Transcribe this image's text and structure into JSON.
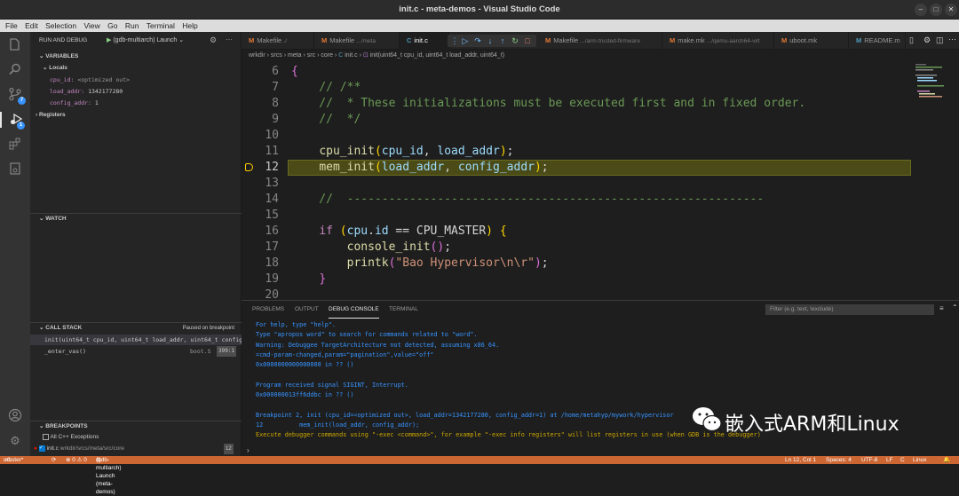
{
  "window": {
    "title": "init.c - meta-demos - Visual Studio Code"
  },
  "menu": [
    "File",
    "Edit",
    "Selection",
    "View",
    "Go",
    "Run",
    "Terminal",
    "Help"
  ],
  "sidebar": {
    "run_label": "RUN AND DEBUG",
    "config": "(gdb-multiarch) Launch",
    "variables_label": "VARIABLES",
    "locals_label": "Locals",
    "locals": [
      {
        "name": "cpu_id:",
        "value": "<optimized out>"
      },
      {
        "name": "load_addr:",
        "value": "1342177280"
      },
      {
        "name": "config_addr:",
        "value": "1"
      }
    ],
    "registers_label": "Registers",
    "watch_label": "WATCH",
    "callstack_label": "CALL STACK",
    "callstack_status": "Paused on breakpoint",
    "frames": [
      {
        "name": "init(uint64_t cpu_id, uint64_t load_addr, uint64_t config",
        "file": ""
      },
      {
        "name": "_enter_vas()",
        "file": "boot.S",
        "line": "399:1"
      }
    ],
    "breakpoints_label": "BREAKPOINTS",
    "breakpoints": [
      {
        "label": "All C++ Exceptions",
        "path": "",
        "count": ""
      },
      {
        "label": "init.c",
        "path": "wrkdir/srcs/meta/src/core",
        "count": "12"
      }
    ]
  },
  "activity": {
    "source_control_badge": "7",
    "debug_badge": "1"
  },
  "tabs": [
    {
      "name": "Makefile",
      "dir": "./"
    },
    {
      "name": "Makefile",
      "dir": ".../meta"
    },
    {
      "name": "init.c",
      "dir": ""
    },
    {
      "name": "Makefile",
      "dir": ".../arm-trusted-firmware"
    },
    {
      "name": "make.mk",
      "dir": ".../qemu-aarch64-virt"
    },
    {
      "name": "uboot.mk",
      "dir": ""
    },
    {
      "name": "README.m",
      "dir": ""
    }
  ],
  "breadcrumb": [
    "wrkdir",
    "srcs",
    "meta",
    "src",
    "core",
    "init.c",
    "init(uint64_t cpu_id, uint64_t load_addr, uint64_t)"
  ],
  "code": {
    "current_line": 12,
    "lines": [
      {
        "n": "6",
        "tokens": [
          {
            "t": "{",
            "c": "c-br2"
          }
        ]
      },
      {
        "n": "7",
        "tokens": [
          {
            "t": "    // /**",
            "c": "c-com"
          }
        ]
      },
      {
        "n": "8",
        "tokens": [
          {
            "t": "    //  * These initializations must be executed first and in fixed order.",
            "c": "c-com"
          }
        ]
      },
      {
        "n": "9",
        "tokens": [
          {
            "t": "    //  */",
            "c": "c-com"
          }
        ]
      },
      {
        "n": "10",
        "tokens": []
      },
      {
        "n": "11",
        "tokens": [
          {
            "t": "    ",
            "c": "c-def"
          },
          {
            "t": "cpu_init",
            "c": "c-fn"
          },
          {
            "t": "(",
            "c": "c-brace"
          },
          {
            "t": "cpu_id",
            "c": "c-var"
          },
          {
            "t": ", ",
            "c": "c-def"
          },
          {
            "t": "load_addr",
            "c": "c-var"
          },
          {
            "t": ")",
            "c": "c-brace"
          },
          {
            "t": ";",
            "c": "c-def"
          }
        ]
      },
      {
        "n": "12",
        "tokens": [
          {
            "t": "    ",
            "c": "c-def"
          },
          {
            "t": "mem_init",
            "c": "c-fn"
          },
          {
            "t": "(",
            "c": "c-brace"
          },
          {
            "t": "load_addr",
            "c": "c-var"
          },
          {
            "t": ", ",
            "c": "c-def"
          },
          {
            "t": "config_addr",
            "c": "c-var"
          },
          {
            "t": ")",
            "c": "c-brace"
          },
          {
            "t": ";",
            "c": "c-def"
          }
        ]
      },
      {
        "n": "13",
        "tokens": []
      },
      {
        "n": "14",
        "tokens": [
          {
            "t": "    //  ------------------------------------------------------------",
            "c": "c-com"
          }
        ]
      },
      {
        "n": "15",
        "tokens": []
      },
      {
        "n": "16",
        "tokens": [
          {
            "t": "    ",
            "c": "c-def"
          },
          {
            "t": "if",
            "c": "c-kw"
          },
          {
            "t": " ",
            "c": "c-def"
          },
          {
            "t": "(",
            "c": "c-brace"
          },
          {
            "t": "cpu",
            "c": "c-var"
          },
          {
            "t": ".",
            "c": "c-def"
          },
          {
            "t": "id",
            "c": "c-var"
          },
          {
            "t": " == CPU_MASTER",
            "c": "c-def"
          },
          {
            "t": ")",
            "c": "c-brace"
          },
          {
            "t": " ",
            "c": "c-def"
          },
          {
            "t": "{",
            "c": "c-brace"
          }
        ]
      },
      {
        "n": "17",
        "tokens": [
          {
            "t": "        ",
            "c": "c-def"
          },
          {
            "t": "console_init",
            "c": "c-fn"
          },
          {
            "t": "()",
            "c": "c-br2"
          },
          {
            "t": ";",
            "c": "c-def"
          }
        ]
      },
      {
        "n": "18",
        "tokens": [
          {
            "t": "        ",
            "c": "c-def"
          },
          {
            "t": "printk",
            "c": "c-fn"
          },
          {
            "t": "(",
            "c": "c-br2"
          },
          {
            "t": "\"Bao Hypervisor\\n\\r\"",
            "c": "c-str"
          },
          {
            "t": ")",
            "c": "c-br2"
          },
          {
            "t": ";",
            "c": "c-def"
          }
        ]
      },
      {
        "n": "19",
        "tokens": [
          {
            "t": "    ",
            "c": "c-def"
          },
          {
            "t": "}",
            "c": "c-br2"
          }
        ]
      },
      {
        "n": "20",
        "tokens": []
      }
    ]
  },
  "panel": {
    "tabs": [
      "PROBLEMS",
      "OUTPUT",
      "DEBUG CONSOLE",
      "TERMINAL"
    ],
    "active_tab": "DEBUG CONSOLE",
    "filter_placeholder": "Filter (e.g. text, !exclude)",
    "console": [
      {
        "text": "For help, type \"help\".",
        "c": ""
      },
      {
        "text": "Type \"apropos word\" to search for commands related to \"word\".",
        "c": ""
      },
      {
        "text": "Warning: Debuggee TargetArchitecture not detected, assuming x86_64.",
        "c": ""
      },
      {
        "text": "=cmd-param-changed,param=\"pagination\",value=\"off\"",
        "c": ""
      },
      {
        "text": "0x0000000000000000 in ?? ()",
        "c": ""
      },
      {
        "text": "",
        "c": ""
      },
      {
        "text": "Program received signal SIGINT, Interrupt.",
        "c": ""
      },
      {
        "text": "0x000000013ff6ddbc in ?? ()",
        "c": ""
      },
      {
        "text": "",
        "c": ""
      },
      {
        "text": "Breakpoint 2, init (cpu_id=<optimized out>, load_addr=1342177280, config_addr=1) at /home/metahyp/mywork/hypervisor",
        "c": ""
      },
      {
        "text": "12          mem_init(load_addr, config_addr);",
        "c": ""
      },
      {
        "text": "Execute debugger commands using \"-exec <command>\", for example \"-exec info registers\" will list registers in use (when GDB is the debugger)",
        "c": "orange"
      }
    ]
  },
  "status": {
    "branch": "master*",
    "problems": "⊗ 0 ⚠ 0",
    "launch": "(gdb-multiarch) Launch (meta-demos)",
    "position": "Ln 12, Col 1",
    "spaces": "Spaces: 4",
    "encoding": "UTF-8",
    "eol": "LF",
    "lang": "C",
    "os": "Linux"
  },
  "watermark": {
    "text": "嵌入式ARM和Linux"
  }
}
